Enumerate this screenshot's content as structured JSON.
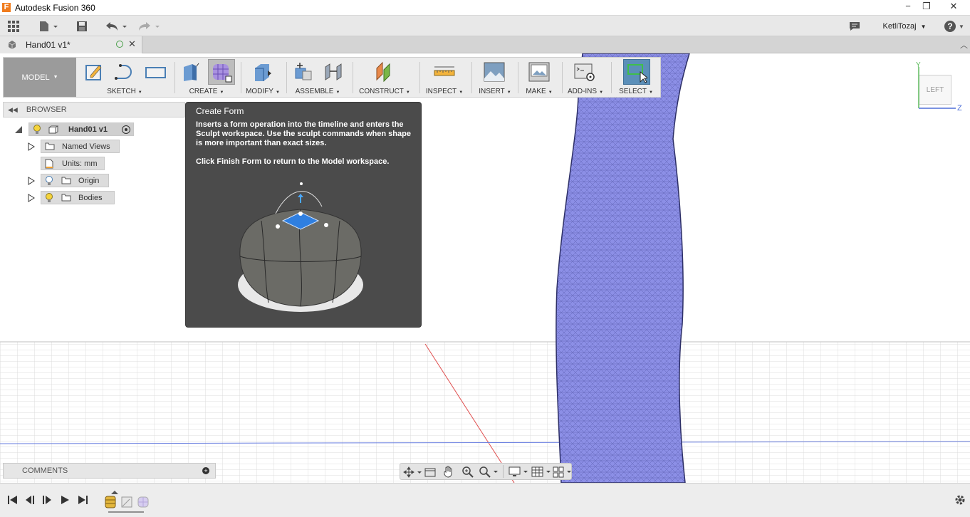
{
  "window": {
    "app_letter": "F",
    "title": "Autodesk Fusion 360",
    "minimize": "−",
    "restore": "❐",
    "close": "✕"
  },
  "qat": {
    "user": "KetliTozaj",
    "help": "?"
  },
  "doc_tab": {
    "title": "Hand01 v1*",
    "close": "✕"
  },
  "toolbar": {
    "workspace": "MODEL",
    "groups": {
      "sketch": "SKETCH",
      "create": "CREATE",
      "modify": "MODIFY",
      "assemble": "ASSEMBLE",
      "construct": "CONSTRUCT",
      "inspect": "INSPECT",
      "insert": "INSERT",
      "make": "MAKE",
      "addins": "ADD-INS",
      "select": "SELECT"
    }
  },
  "browser": {
    "header": "BROWSER",
    "root": "Hand01 v1",
    "items": [
      {
        "label": "Named Views"
      },
      {
        "label": "Units: mm"
      },
      {
        "label": "Origin"
      },
      {
        "label": "Bodies"
      }
    ]
  },
  "tooltip": {
    "title": "Create Form",
    "description": "Inserts a form operation into the timeline and enters the Sculpt workspace. Use the sculpt commands when shape is more important than exact sizes.",
    "note": "Click Finish Form to return to the Model workspace."
  },
  "viewcube": {
    "face": "LEFT",
    "axis_y": "Y",
    "axis_z": "Z"
  },
  "comments": {
    "label": "COMMENTS"
  },
  "colors": {
    "accent": "#5b8fb9",
    "mesh": "#8c8fe6",
    "tooltip_bg": "#4b4b4b"
  }
}
